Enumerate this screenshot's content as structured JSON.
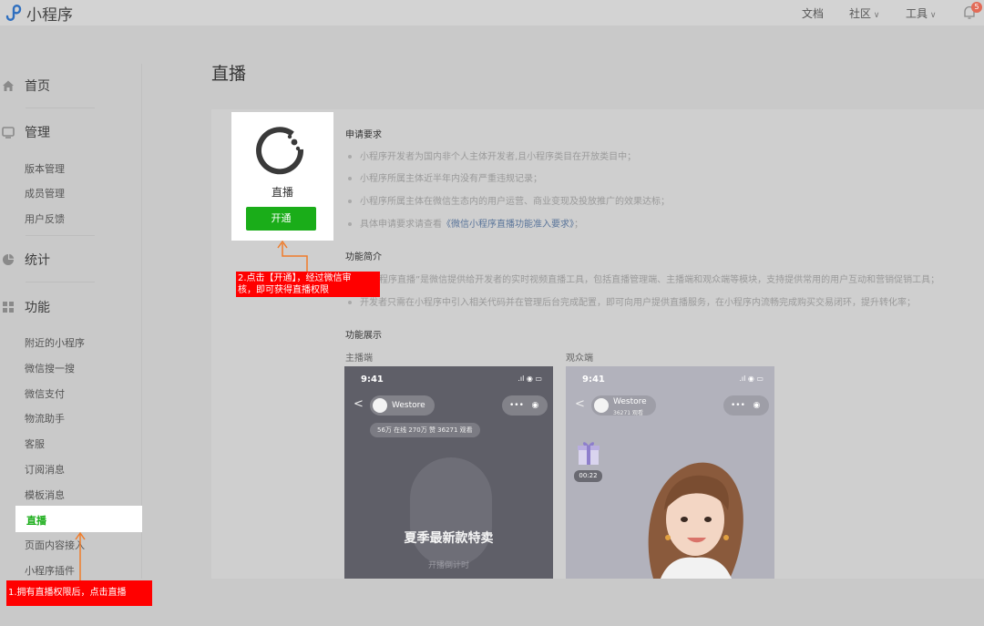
{
  "header": {
    "app_title": "小程序",
    "links": {
      "docs": "文档",
      "community": "社区",
      "tools": "工具"
    },
    "notification_count": "5"
  },
  "sidebar": {
    "home": "首页",
    "manage": {
      "label": "管理",
      "items": [
        "版本管理",
        "成员管理",
        "用户反馈"
      ]
    },
    "stats": "统计",
    "features": {
      "label": "功能",
      "items": [
        "附近的小程序",
        "微信搜一搜",
        "微信支付",
        "物流助手",
        "客服",
        "订阅消息",
        "模板消息",
        "直播",
        "页面内容接入",
        "小程序插件"
      ]
    }
  },
  "main": {
    "page_title": "直播",
    "card": {
      "name": "直播",
      "open_button": "开通"
    },
    "requirements": {
      "title": "申请要求",
      "items": [
        "小程序开发者为国内非个人主体开发者,且小程序类目在开放类目中；",
        "小程序所属主体近半年内没有严重违规记录；",
        "小程序所属主体在微信生态内的用户运营、商业变现及投放推广的效果达标；"
      ],
      "last_prefix": "具体申请要求请查看",
      "last_link": "《微信小程序直播功能准入要求》",
      "last_suffix": "；"
    },
    "intro": {
      "title": "功能简介",
      "line1": "程序直播”是微信提供给开发者的实时视频直播工具，包括直播管理端、主播端和观众端等模块，支持提供常用的用户互动和营销促销工具；",
      "line2": "开发者只需在小程序中引入相关代码并在管理后台完成配置，即可向用户提供直播服务，在小程序内流畅完成购买交易闭环，提升转化率；"
    },
    "demo": {
      "title": "功能展示",
      "host_label": "主播端",
      "viewer_label": "观众端",
      "host_phone": {
        "time": "9:41",
        "store": "Westore",
        "stats": "56万 在线  270万 赞  36271 观看",
        "promo_title": "夏季最新款特卖",
        "promo_sub": "开播倒计时"
      },
      "viewer_phone": {
        "time": "9:41",
        "store": "Westore",
        "viewers": "36271 观看",
        "timer": "00:22"
      }
    }
  },
  "annotations": {
    "step1": "1.拥有直播权限后，点击直播",
    "step2_line1": "2.点击【开通】，经过微信审",
    "step2_line2": "核，即可获得直播权限"
  },
  "colors": {
    "accent_green": "#1aad19",
    "callout_red": "#ff0000",
    "arrow_orange": "#f07c2a",
    "badge_red": "#e26b57"
  }
}
